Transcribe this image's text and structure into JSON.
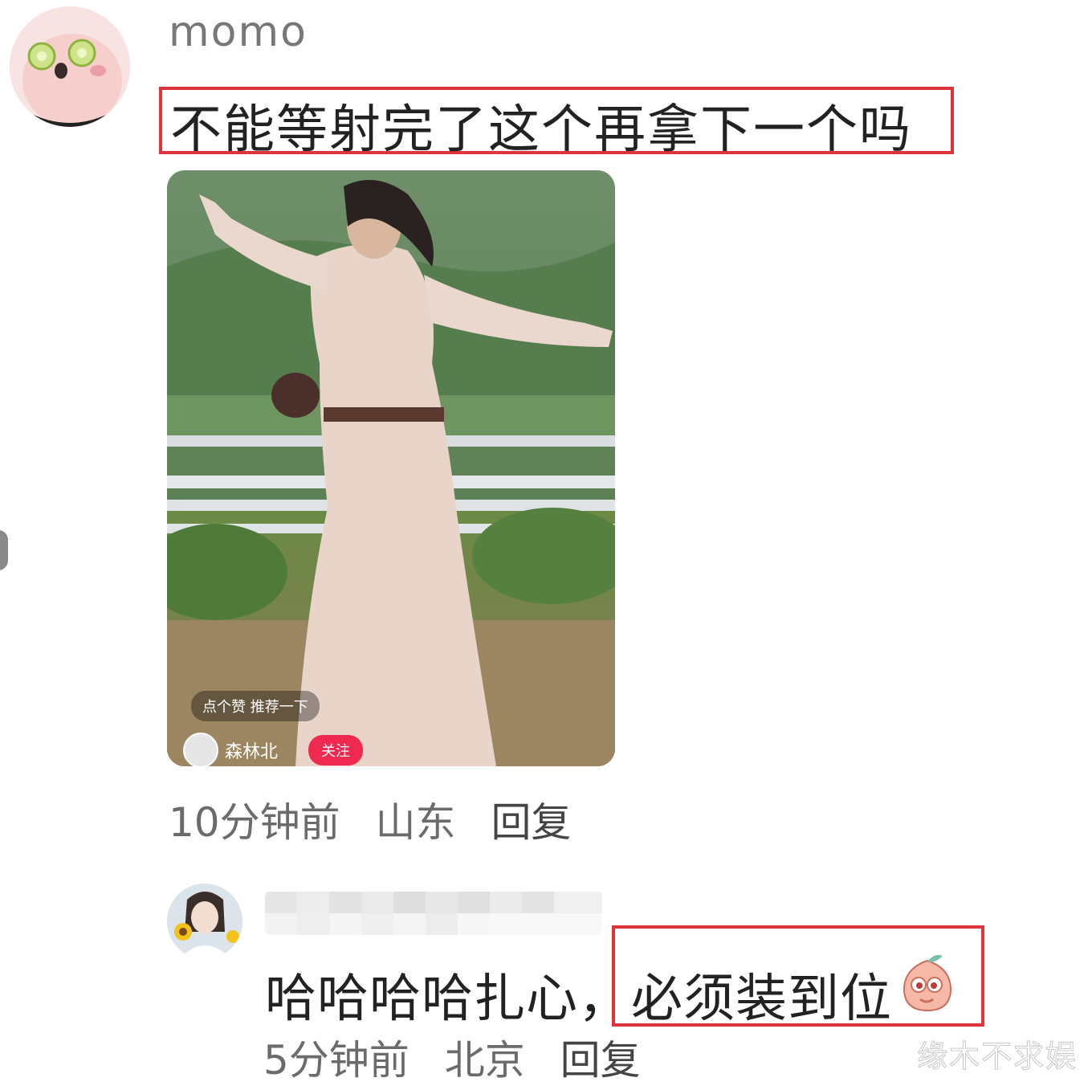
{
  "comment": {
    "username": "momo",
    "text": "不能等射完了这个再拿下一个吗",
    "time": "10分钟前",
    "location": "山东",
    "reply_label": "回复",
    "photo": {
      "pill_text": "点个赞 推荐一下",
      "author": "森林北",
      "follow_label": "关注"
    }
  },
  "reply": {
    "text_part1": "哈哈哈哈扎心，",
    "text_part2": "必须装到位",
    "time": "5分钟前",
    "location": "北京",
    "reply_label": "回复"
  },
  "watermark": "缘木不求娱",
  "colors": {
    "highlight_border": "#e0343c",
    "follow_button": "#f02950",
    "meta_text": "#6b6b6b"
  }
}
